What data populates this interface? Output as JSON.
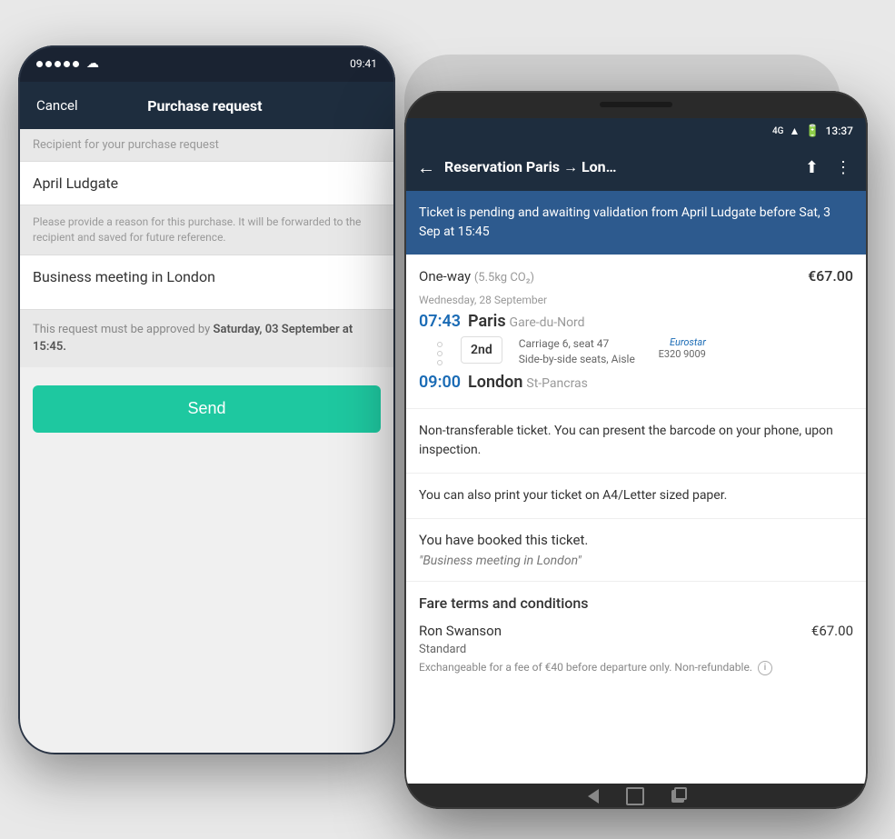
{
  "background": "#e8e8e8",
  "phone_left": {
    "status_bar": {
      "time": "09:41",
      "signal": "•••••"
    },
    "nav_bar": {
      "cancel_label": "Cancel",
      "title": "Purchase request"
    },
    "form": {
      "recipient_label": "Recipient for your purchase request",
      "recipient_value": "April Ludgate",
      "reason_label": "Please provide a reason for this purchase. It will be forwarded to the recipient and saved for future reference.",
      "reason_value": "Business meeting in London",
      "approval_notice": "This request must be approved by ",
      "approval_date": "Saturday, 03 September at 15:45.",
      "send_label": "Send"
    }
  },
  "phone_right": {
    "status_bar": {
      "network": "4G",
      "time": "13:37"
    },
    "nav_bar": {
      "title": "Reservation Paris → Lon…",
      "back_arrow": "←"
    },
    "pending_notice": "Ticket is pending and awaiting validation from April Ludgate before Sat, 3 Sep at 15:45",
    "ticket": {
      "type": "One-way",
      "co2": "(5.5kg CO₂)",
      "price": "€67.00",
      "date": "Wednesday, 28 September",
      "departure_time": "07:43",
      "departure_station": "Paris",
      "departure_sub": "Gare-du-Nord",
      "seat_class": "2nd",
      "seat_detail_1": "Carriage 6, seat 47",
      "seat_detail_2": "Side-by-side seats, Aisle",
      "train_brand": "Eurostar",
      "train_number": "E320 9009",
      "arrival_time": "09:00",
      "arrival_station": "London",
      "arrival_sub": "St-Pancras"
    },
    "info_1": "Non-transferable ticket. You can present the barcode on your phone, upon inspection.",
    "info_2": "You can also print your ticket on A4/Letter sized paper.",
    "booked": {
      "title": "You have booked this ticket.",
      "reason": "\"Business meeting in London\""
    },
    "fare": {
      "section_title": "Fare terms and conditions",
      "passenger_name": "Ron Swanson",
      "passenger_price": "€67.00",
      "fare_class": "Standard",
      "fare_terms": "Exchangeable for a fee of €40 before departure only. Non-refundable."
    }
  }
}
